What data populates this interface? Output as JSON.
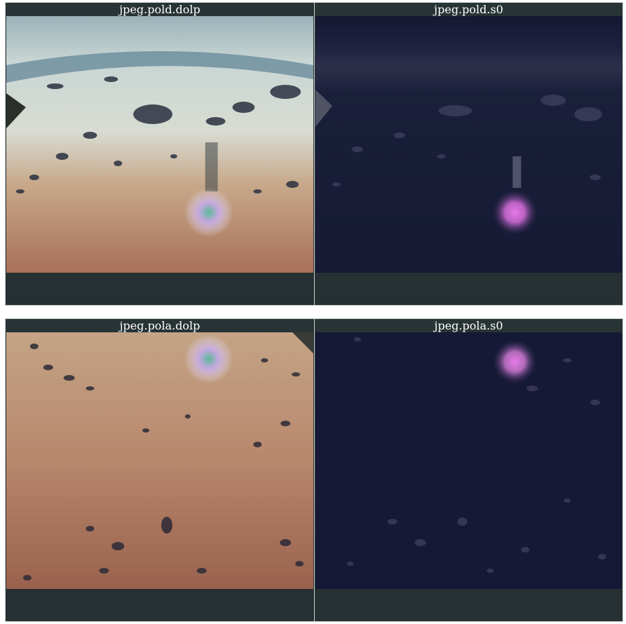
{
  "panels": [
    {
      "id": "pold",
      "images": [
        {
          "title": "jpeg.pold.dolp",
          "kind": "dolp-horizon"
        },
        {
          "title": "jpeg.pold.s0",
          "kind": "s0-horizon"
        }
      ]
    },
    {
      "id": "pola",
      "images": [
        {
          "title": "jpeg.pola.dolp",
          "kind": "dolp-surface"
        },
        {
          "title": "jpeg.pola.s0",
          "kind": "s0-surface"
        }
      ]
    }
  ],
  "colors": {
    "frame_border": "#c9cfcf",
    "panel_bg": "#263032",
    "title_text": "#ffffff",
    "s0_sky": "#161a36",
    "dolp_ground": "#b88864",
    "glint": "#d86adf"
  }
}
